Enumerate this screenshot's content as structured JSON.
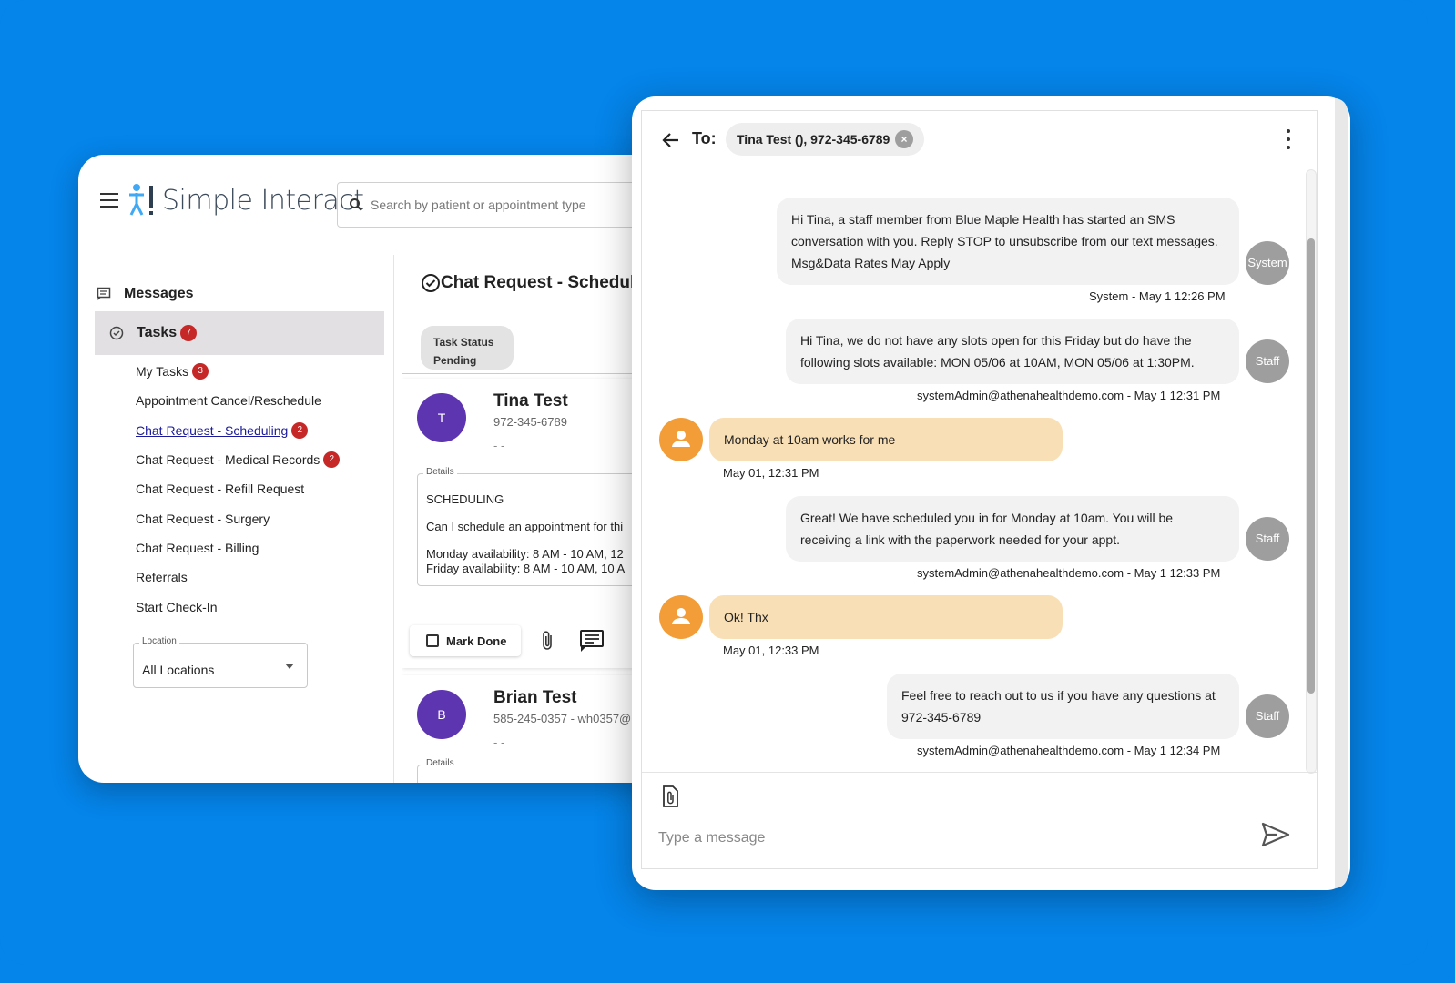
{
  "app": {
    "brand_name": "Simple Interact",
    "search_placeholder": "Search by patient or appointment type"
  },
  "sidebar": {
    "messages_label": "Messages",
    "tasks_label": "Tasks",
    "tasks_count": "7",
    "items": [
      {
        "label": "My Tasks",
        "count": "3"
      },
      {
        "label": "Appointment Cancel/Reschedule",
        "count": ""
      },
      {
        "label": "Chat Request - Scheduling",
        "count": "2",
        "active": true
      },
      {
        "label": "Chat Request - Medical Records",
        "count": "2"
      },
      {
        "label": "Chat Request - Refill Request",
        "count": ""
      },
      {
        "label": "Chat Request - Surgery",
        "count": ""
      },
      {
        "label": "Chat Request - Billing",
        "count": ""
      },
      {
        "label": "Referrals",
        "count": ""
      },
      {
        "label": "Start Check-In",
        "count": ""
      }
    ],
    "location": {
      "label": "Location",
      "value": "All Locations"
    }
  },
  "task_panel": {
    "title": "Chat Request - Scheduli",
    "status_label": "Task Status",
    "status_value": "Pending",
    "cards": [
      {
        "initial": "T",
        "name": "Tina Test",
        "phone": "972-345-6789",
        "dash": "- -",
        "details_label": "Details",
        "details": [
          "SCHEDULING",
          "Can I schedule an appointment for thi",
          "Monday availability: 8 AM - 10 AM, 12",
          "Friday availability: 8 AM - 10 AM, 10 A"
        ],
        "mark_done_label": "Mark Done"
      },
      {
        "initial": "B",
        "name": "Brian Test",
        "phone": "585-245-0357 - wh0357@",
        "dash": "- -",
        "details_label": "Details"
      }
    ]
  },
  "chat": {
    "to_label": "To:",
    "recipient": "Tina Test (), 972-345-6789",
    "chip_close": "×",
    "messages": [
      {
        "dir": "out",
        "text": "Hi Tina, a staff member from Blue Maple Health has started an SMS conversation with you. Reply STOP to unsubscribe from our text messages. Msg&Data Rates May Apply",
        "meta": "System - May 1 12:26 PM",
        "sender": "System"
      },
      {
        "dir": "out",
        "text": "Hi Tina, we do not have any slots open for this Friday but do have the following slots available: MON 05/06 at 10AM, MON 05/06 at 1:30PM.",
        "meta": "systemAdmin@athenahealthdemo.com - May 1 12:31 PM",
        "sender": "Staff"
      },
      {
        "dir": "in",
        "text": "Monday at 10am works for me",
        "meta": "May 01, 12:31 PM"
      },
      {
        "dir": "out",
        "text": "Great! We have scheduled you in for Monday at 10am. You will be receiving a link with the paperwork needed for your appt.",
        "meta": "systemAdmin@athenahealthdemo.com - May 1 12:33 PM",
        "sender": "Staff"
      },
      {
        "dir": "in",
        "text": "Ok! Thx",
        "meta": "May 01, 12:33 PM"
      },
      {
        "dir": "out",
        "text": "Feel free to reach out to us if you have any questions at 972-345-6789",
        "meta": "systemAdmin@athenahealthdemo.com - May 1 12:34 PM",
        "sender": "Staff"
      }
    ],
    "composer_placeholder": "Type a message"
  },
  "colors": {
    "background": "#0584e9",
    "badge": "#c62828",
    "avatar": "#5e35b1",
    "incoming_bubble": "#f9dfb5",
    "outgoing_bubble": "#f2f2f3",
    "user_avatar": "#f29d38",
    "sender_avatar": "#9e9e9e"
  }
}
